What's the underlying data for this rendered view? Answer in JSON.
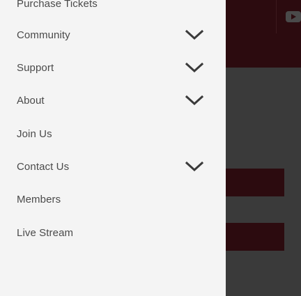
{
  "menu": {
    "items": [
      {
        "label": "Purchase Tickets",
        "has_submenu": false
      },
      {
        "label": "Community",
        "has_submenu": true
      },
      {
        "label": "Support",
        "has_submenu": true
      },
      {
        "label": "About",
        "has_submenu": true
      },
      {
        "label": "Join Us",
        "has_submenu": false
      },
      {
        "label": "Contact Us",
        "has_submenu": true
      },
      {
        "label": "Members",
        "has_submenu": false
      },
      {
        "label": "Live Stream",
        "has_submenu": false
      }
    ]
  },
  "icons": {
    "expand": "chevron-down-icon",
    "social": "youtube-icon"
  },
  "colors": {
    "drawer_background": "#f4f4f4",
    "menu_text": "#4a4a4a",
    "header_background": "#2c0b0f",
    "page_background": "#3a3a3a"
  }
}
